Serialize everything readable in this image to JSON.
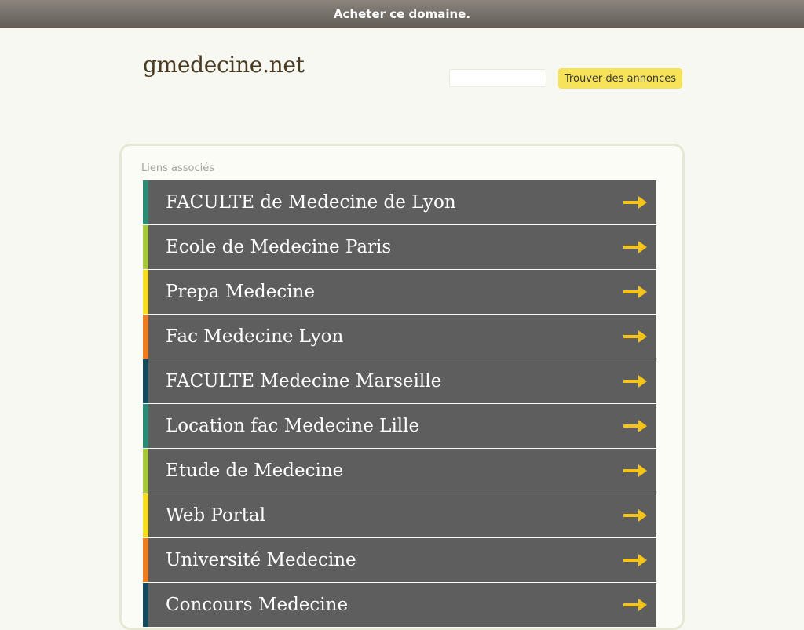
{
  "topbar": {
    "label": "Acheter ce domaine."
  },
  "header": {
    "site_title": "gmedecine.net",
    "search_placeholder": "",
    "search_button_label": "Trouver des annonces"
  },
  "panel": {
    "section_label": "Liens associés",
    "links": [
      {
        "label": "FACULTE de Medecine de Lyon",
        "stripe_color": "#2a8c75"
      },
      {
        "label": "Ecole de Medecine Paris",
        "stripe_color": "#a8c83a"
      },
      {
        "label": "Prepa Medecine",
        "stripe_color": "#f5dd1e"
      },
      {
        "label": "Fac Medecine Lyon",
        "stripe_color": "#f07b1f"
      },
      {
        "label": "FACULTE Medecine Marseille",
        "stripe_color": "#134a5d"
      },
      {
        "label": "Location fac Medecine Lille",
        "stripe_color": "#2a8c75"
      },
      {
        "label": "Etude de Medecine",
        "stripe_color": "#a8c83a"
      },
      {
        "label": "Web Portal",
        "stripe_color": "#f5dd1e"
      },
      {
        "label": "Université Medecine",
        "stripe_color": "#f07b1f"
      },
      {
        "label": "Concours Medecine",
        "stripe_color": "#134a5d"
      }
    ],
    "arrow_icon": "arrow-right-icon",
    "arrow_color": "#f6c417"
  }
}
